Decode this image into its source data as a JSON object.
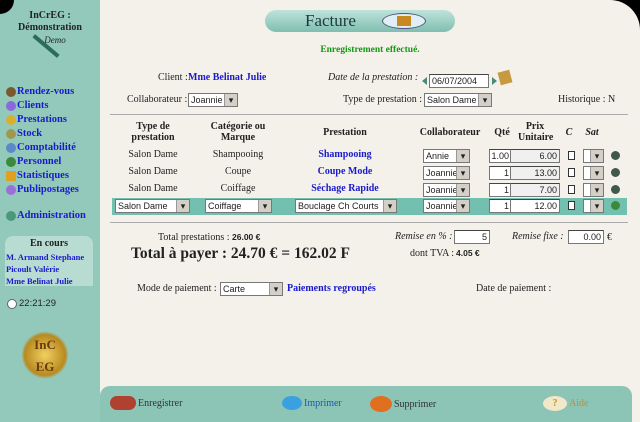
{
  "sidebar": {
    "app_title": "InCrEG :",
    "app_subtitle": "Démonstration",
    "demo_label": "Demo",
    "nav": [
      {
        "label": "Rendez-vous"
      },
      {
        "label": "Clients"
      },
      {
        "label": "Prestations"
      },
      {
        "label": "Stock"
      },
      {
        "label": "Comptabilité"
      },
      {
        "label": "Personnel"
      },
      {
        "label": "Statistiques"
      },
      {
        "label": "Publipostages"
      }
    ],
    "admin": "Administration",
    "en_cours_title": "En cours",
    "en_cours": [
      "M. Armand Stephane",
      "Picoult Valérie",
      "Mme Belinat Julie"
    ],
    "clock": "22:21:29",
    "logo_text": "InCrEG"
  },
  "header": {
    "title": "Facture",
    "status": "Enregistrement effectué."
  },
  "form": {
    "client_label": "Client :",
    "client": "Mme Belinat Julie",
    "date_label": "Date de la prestation :",
    "date": "06/07/2004",
    "collab_label": "Collaborateur :",
    "collab": "Joannie",
    "type_label": "Type de prestation :",
    "type": "Salon Dame",
    "historique": "Historique : N"
  },
  "table": {
    "headers": {
      "type": "Type de prestation",
      "cat": "Catégorie ou Marque",
      "prestation": "Prestation",
      "collab": "Collaborateur",
      "qte": "Qté",
      "prix": "Prix Unitaire",
      "c": "C",
      "sat": "Sat"
    },
    "rows": [
      {
        "type": "Salon Dame",
        "cat": "Shampooing",
        "prestation": "Shampooing",
        "collab": "Annie",
        "qte": "1.00",
        "prix": "6.00"
      },
      {
        "type": "Salon Dame",
        "cat": "Coupe",
        "prestation": "Coupe Mode",
        "collab": "Joannie",
        "qte": "1",
        "prix": "13.00"
      },
      {
        "type": "Salon Dame",
        "cat": "Coiffage",
        "prestation": "Séchage Rapide",
        "collab": "Joannie",
        "qte": "1",
        "prix": "7.00"
      }
    ],
    "edit_row": {
      "type": "Salon Dame",
      "cat": "Coiffage",
      "prestation": "Bouclage Ch Courts",
      "collab": "Joannie",
      "qte": "1",
      "prix": "12.00"
    }
  },
  "totals": {
    "total_label": "Total prestations :",
    "total": "26.00 €",
    "remise_pct_label": "Remise en % :",
    "remise_pct": "5",
    "remise_fixe_label": "Remise fixe :",
    "remise_fixe": "0.00",
    "euro": "€",
    "a_payer": "Total à payer : 24.70 € = 162.02 F",
    "tva_label": "dont TVA :",
    "tva": "4.05 €"
  },
  "payment": {
    "mode_label": "Mode de paiement :",
    "mode": "Carte",
    "regroupes": "Paiements regroupés",
    "date_label": "Date de paiement :"
  },
  "footer": {
    "save": "Enregistrer",
    "print": "Imprimer",
    "delete": "Supprimer",
    "help": "Aide"
  },
  "colors": {
    "teal": "#93c9bb",
    "link": "#1a1acc",
    "success": "#119911"
  }
}
